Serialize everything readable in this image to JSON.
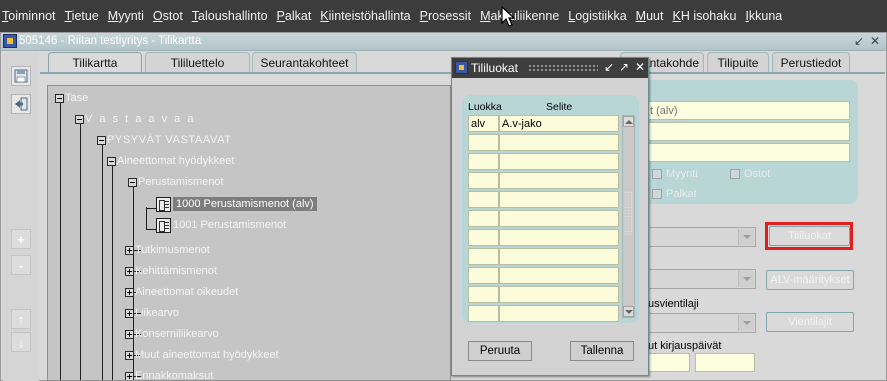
{
  "menu": [
    "Toiminnot",
    "Tietue",
    "Myynti",
    "Ostot",
    "Taloushallinto",
    "Palkat",
    "Kiinteistöhallinta",
    "Prosessit",
    "Maksuliikenne",
    "Logistiikka",
    "Muut",
    "KH isohaku",
    "Ikkuna"
  ],
  "window": {
    "title": "505146 - Riitan testiyritys - Tilikartta",
    "controls": [
      "↙",
      "✕"
    ]
  },
  "toolbar": {
    "save_icon": "save-icon",
    "exit_icon": "exit-icon",
    "plus": "+",
    "minus": "-",
    "up": "↑",
    "down": "↓"
  },
  "tabs": [
    "Tilikartta",
    "Tililuettelo",
    "Seurantakohteet",
    "Seurantakohde",
    "Tilipuite",
    "Perustiedot"
  ],
  "tree": [
    {
      "label": "Tase"
    },
    {
      "label": "V a s t a a v a a"
    },
    {
      "label": "PYSYVÄT VASTAAVAT"
    },
    {
      "label": "Aineettomat hyödykkeet"
    },
    {
      "label": "Perustamismenot"
    },
    {
      "label": "1000 Perustamismenot (alv)"
    },
    {
      "label": "1001 Perustamismenot"
    },
    {
      "label": "Tutkimusmenot"
    },
    {
      "label": "Kehittämismenot"
    },
    {
      "label": "Aineettomat oikeudet"
    },
    {
      "label": "Liikearvo"
    },
    {
      "label": "Konserniliikearvo"
    },
    {
      "label": "Muut aineettomat hyödykkeet"
    },
    {
      "label": "Ennakkomaksut"
    }
  ],
  "form": {
    "field1": "t (alv)",
    "checks": [
      "Myynti",
      "Ostot",
      "Palkat"
    ],
    "tililuokat_button": "Tililuokat",
    "alv_button": "ALV-määritykset",
    "vientilajit_button": "Vientilajit",
    "vientilaji_label": "usvientilaji",
    "kirjauspaivat_label": "ut kirjauspäivät"
  },
  "dialog": {
    "title": "Tililuokat",
    "controls": [
      "↙",
      "↗",
      "✕"
    ],
    "headers": {
      "luokka": "Luokka",
      "selite": "Selite"
    },
    "rows": [
      {
        "luokka": "alv",
        "selite": "A.v-jako"
      },
      {
        "luokka": "",
        "selite": ""
      },
      {
        "luokka": "",
        "selite": ""
      },
      {
        "luokka": "",
        "selite": ""
      },
      {
        "luokka": "",
        "selite": ""
      },
      {
        "luokka": "",
        "selite": ""
      },
      {
        "luokka": "",
        "selite": ""
      },
      {
        "luokka": "",
        "selite": ""
      },
      {
        "luokka": "",
        "selite": ""
      },
      {
        "luokka": "",
        "selite": ""
      },
      {
        "luokka": "",
        "selite": ""
      }
    ],
    "cancel_button": "Peruuta",
    "save_button": "Tallenna"
  },
  "colors": {
    "highlight": "#e02020",
    "panel": "#b8d6d6"
  }
}
